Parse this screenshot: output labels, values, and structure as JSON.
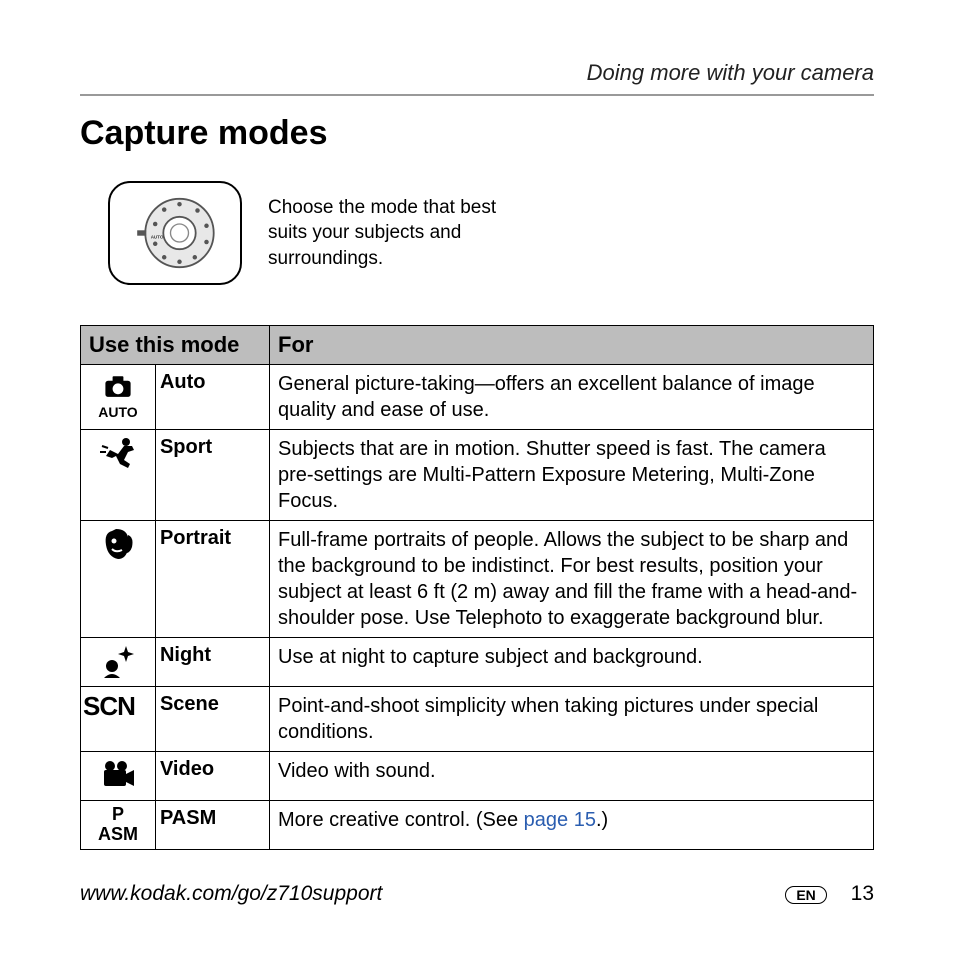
{
  "chapter": "Doing more with your camera",
  "section_title": "Capture modes",
  "intro": "Choose the mode that best suits your subjects and surroundings.",
  "table": {
    "header_mode": "Use this mode",
    "header_for": "For",
    "rows": [
      {
        "icon_label": "AUTO",
        "name": "Auto",
        "desc": "General picture-taking—offers an excellent balance of image quality and ease of use."
      },
      {
        "icon_label": "",
        "name": "Sport",
        "desc": "Subjects that are in motion. Shutter speed is fast. The camera pre-settings are Multi-Pattern Exposure Metering, Multi-Zone Focus."
      },
      {
        "icon_label": "",
        "name": "Portrait",
        "desc": "Full-frame portraits of people. Allows the subject to be sharp and the background to be indistinct. For best results, position your subject at least 6 ft (2 m) away and fill the frame with a head-and-shoulder pose. Use Telephoto to exaggerate background blur."
      },
      {
        "icon_label": "",
        "name": "Night",
        "desc": "Use at night to capture subject and background."
      },
      {
        "icon_label": "SCN",
        "name": "Scene",
        "desc": "Point-and-shoot simplicity when taking pictures under special conditions."
      },
      {
        "icon_label": "",
        "name": "Video",
        "desc": "Video with sound."
      },
      {
        "icon_label_line1": "P",
        "icon_label_line2": "ASM",
        "name": "PASM",
        "desc_prefix": "More creative control. (See ",
        "desc_link": "page 15",
        "desc_suffix": ".)"
      }
    ]
  },
  "footer": {
    "url": "www.kodak.com/go/z710support",
    "lang": "EN",
    "page": "13"
  }
}
